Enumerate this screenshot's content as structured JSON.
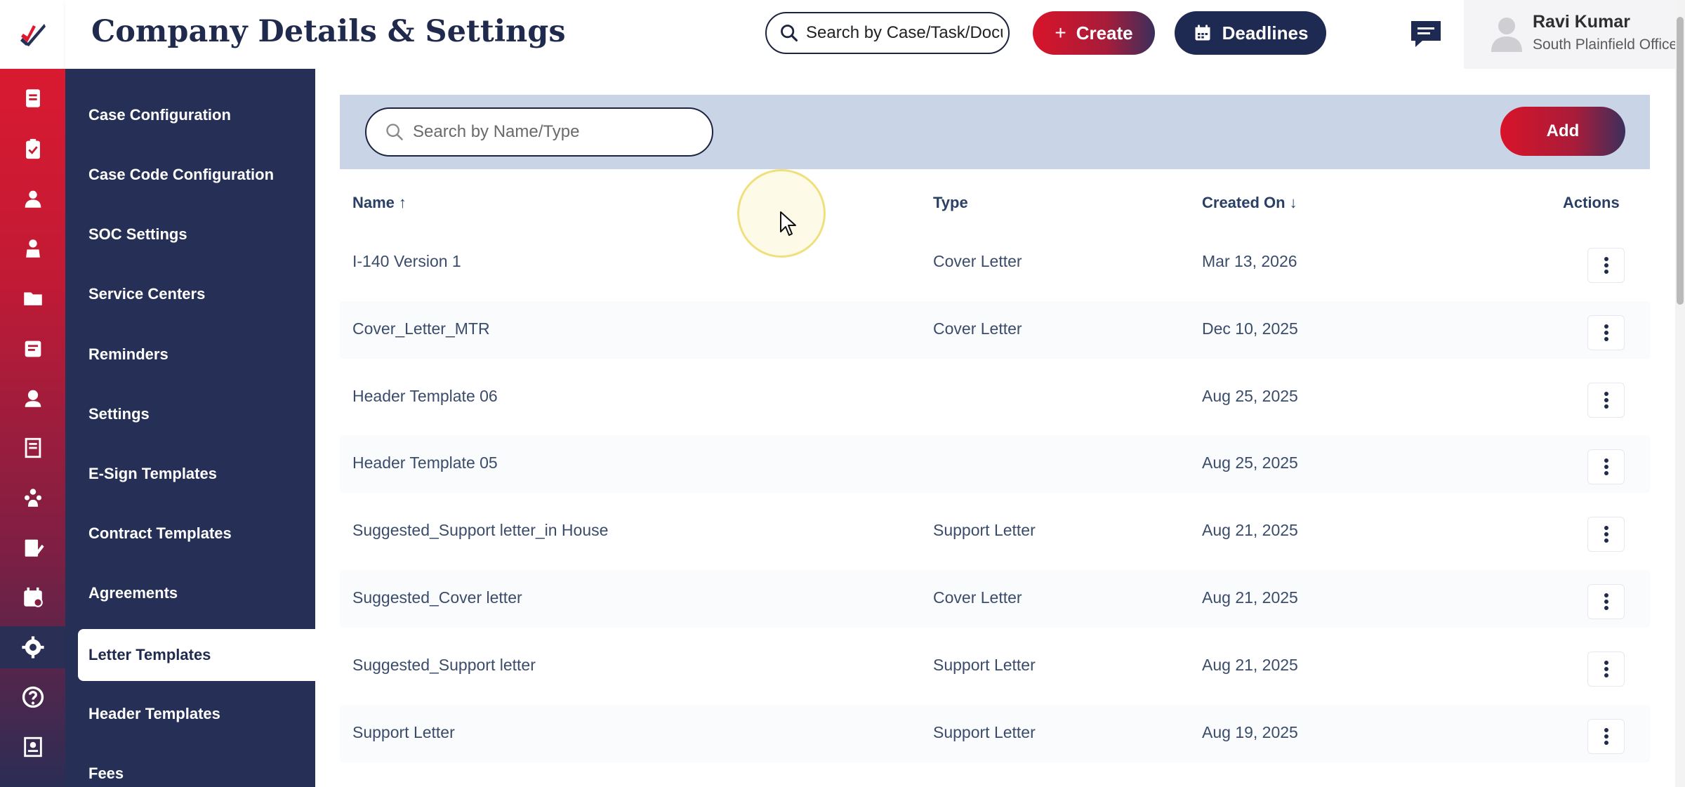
{
  "header": {
    "title": "Company Details & Settings",
    "search_placeholder": "Search by Case/Task/Docu",
    "create_label": "Create",
    "deadlines_label": "Deadlines",
    "user_name": "Ravi Kumar",
    "user_office": "South Plainfield Office"
  },
  "rail_icons": [
    "edit-icon",
    "documents-icon",
    "clipboard-icon",
    "contacts-icon",
    "person-icon",
    "folder-icon",
    "notes-icon",
    "support-agent-icon",
    "ledger-icon",
    "team-icon",
    "signature-icon",
    "calendar-icon",
    "settings-icon",
    "help-icon",
    "book-icon"
  ],
  "settings_nav": {
    "items": [
      {
        "label": "Case Configuration"
      },
      {
        "label": "Case Code Configuration"
      },
      {
        "label": "SOC Settings"
      },
      {
        "label": "Service Centers"
      },
      {
        "label": "Reminders"
      },
      {
        "label": "Settings"
      },
      {
        "label": "E-Sign Templates"
      },
      {
        "label": "Contract Templates"
      },
      {
        "label": "Agreements"
      },
      {
        "label": "Letter Templates"
      },
      {
        "label": "Header Templates"
      },
      {
        "label": "Fees"
      }
    ],
    "active": "Letter Templates"
  },
  "toolbar": {
    "search_placeholder": "Search by Name/Type",
    "add_label": "Add"
  },
  "table": {
    "columns": [
      {
        "label": "Name",
        "sort": "asc"
      },
      {
        "label": "Type"
      },
      {
        "label": "Created On",
        "sort": "desc"
      },
      {
        "label": "Actions"
      }
    ],
    "rows": [
      {
        "name": "I-140 Version 1",
        "type": "Cover Letter",
        "created": "Mar 13, 2026"
      },
      {
        "name": "Cover_Letter_MTR",
        "type": "Cover Letter",
        "created": "Dec 10, 2025"
      },
      {
        "name": "Header Template 06",
        "type": "",
        "created": "Aug 25, 2025"
      },
      {
        "name": "Header Template 05",
        "type": "",
        "created": "Aug 25, 2025"
      },
      {
        "name": "Suggested_Support letter_in House",
        "type": "Support Letter",
        "created": "Aug 21, 2025"
      },
      {
        "name": "Suggested_Cover letter",
        "type": "Cover Letter",
        "created": "Aug 21, 2025"
      },
      {
        "name": "Suggested_Support letter",
        "type": "Support Letter",
        "created": "Aug 21, 2025"
      },
      {
        "name": "Support Letter",
        "type": "Support Letter",
        "created": "Aug 19, 2025"
      }
    ]
  },
  "colors": {
    "brand_red": "#e0182d",
    "navy": "#263056",
    "toolbar_bg": "#c9d5e7"
  }
}
